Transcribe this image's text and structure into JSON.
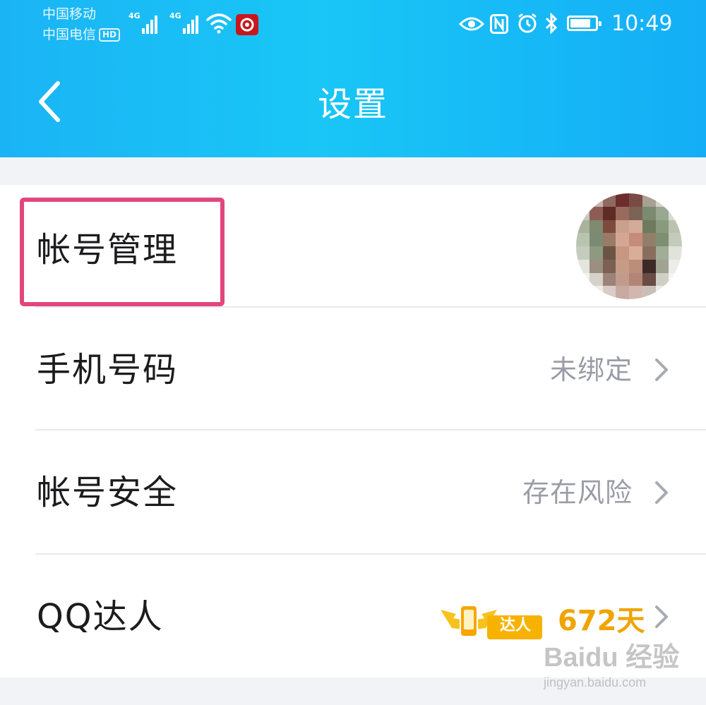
{
  "status_bar": {
    "carrier_1": "中国移动",
    "carrier_2": "中国电信",
    "hd_label": "HD",
    "network_1": "4G",
    "network_2": "4G",
    "time": "10:49",
    "icons": [
      "eye-care-icon",
      "nfc-icon",
      "alarm-icon",
      "bluetooth-icon",
      "battery-icon"
    ]
  },
  "header": {
    "title": "设置",
    "back_icon": "chevron-left-icon"
  },
  "settings": {
    "items": [
      {
        "label": "帐号管理",
        "value": ""
      },
      {
        "label": "手机号码",
        "value": "未绑定"
      },
      {
        "label": "帐号安全",
        "value": "存在风险"
      },
      {
        "label": "QQ达人",
        "value": "672天",
        "badge": "达人"
      }
    ]
  },
  "watermark": {
    "brand": "Baidu 经验",
    "url": "jingyan.baidu.com"
  },
  "colors": {
    "header_gradient": [
      "#1ab4f5",
      "#19c6f6",
      "#14aef6"
    ],
    "highlight": "#e2467d",
    "daren": "#f0a400"
  }
}
